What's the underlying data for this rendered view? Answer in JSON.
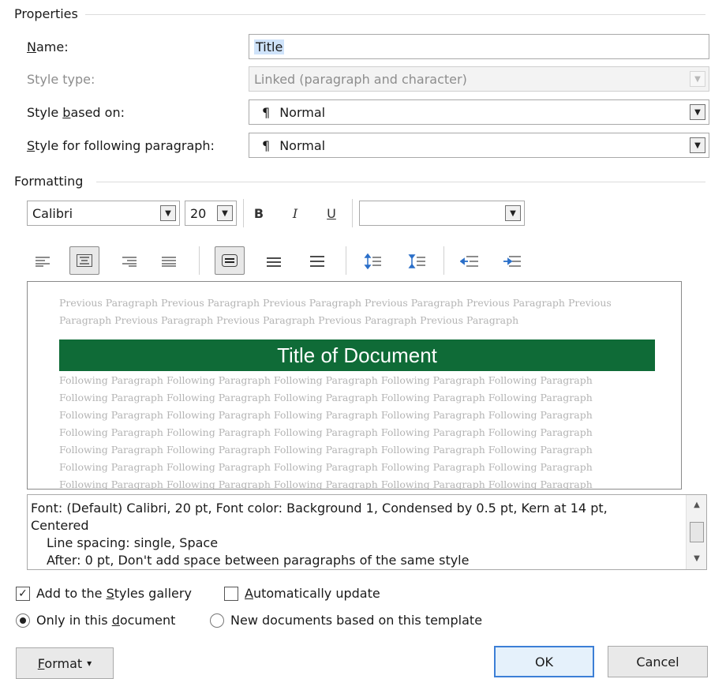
{
  "properties": {
    "section_title": "Properties",
    "name": {
      "label": "Name:",
      "value": "Title"
    },
    "style_type": {
      "label": "Style type:",
      "value": "Linked (paragraph and character)"
    },
    "style_based_on": {
      "label": "Style based on:",
      "value": "Normal"
    },
    "style_following": {
      "label": "Style for following paragraph:",
      "value": "Normal"
    },
    "paragraph_mark": "¶"
  },
  "formatting": {
    "section_title": "Formatting",
    "font_name": "Calibri",
    "font_size": "20",
    "bold": "B",
    "italic": "I",
    "underline": "U",
    "color_value": ""
  },
  "preview": {
    "previous_text": "Previous Paragraph Previous Paragraph Previous Paragraph Previous Paragraph Previous Paragraph Previous Paragraph Previous Paragraph Previous Paragraph Previous Paragraph Previous Paragraph",
    "title_text": "Title of Document",
    "following_text": "Following Paragraph Following Paragraph Following Paragraph Following Paragraph Following Paragraph Following Paragraph Following Paragraph Following Paragraph Following Paragraph Following Paragraph Following Paragraph Following Paragraph Following Paragraph Following Paragraph Following Paragraph Following Paragraph Following Paragraph Following Paragraph Following Paragraph Following Paragraph Following Paragraph Following Paragraph Following Paragraph Following Paragraph Following Paragraph Following Paragraph Following Paragraph Following Paragraph Following Paragraph Following Paragraph Following Paragraph Following Paragraph Following Paragraph Following Paragraph Following Paragraph Following Paragraph Following Paragraph Following Paragraph Following Paragraph Following Paragraph",
    "title_bg": "#0f6b37"
  },
  "description": {
    "line1": "Font: (Default) Calibri, 20 pt, Font color: Background 1, Condensed by  0.5 pt, Kern at 14 pt,",
    "line2": "Centered",
    "line3": "Line spacing:  single, Space",
    "line4": "After:  0 pt, Don't add space between paragraphs of the same style"
  },
  "options": {
    "add_to_gallery": {
      "pre": "Add to the ",
      "key": "S",
      "post": "tyles gallery",
      "checked": true
    },
    "auto_update": {
      "pre": "",
      "key": "A",
      "post": "utomatically update",
      "checked": false
    },
    "only_this_doc": {
      "pre": "Only in this ",
      "key": "d",
      "post": "ocument",
      "selected": true
    },
    "new_docs": {
      "label": "New documents based on this template",
      "selected": false
    }
  },
  "buttons": {
    "format": "Format",
    "ok": "OK",
    "cancel": "Cancel"
  },
  "icons": {
    "dropdown": "▼",
    "check": "✓",
    "format_arrow": "▾",
    "scroll_up": "▲",
    "scroll_down": "▼"
  }
}
